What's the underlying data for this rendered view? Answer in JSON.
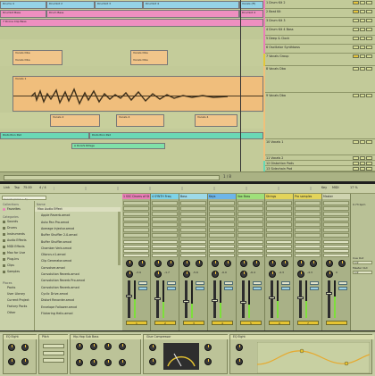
{
  "arrangement": {
    "clips": [
      {
        "label": "Drums 4",
        "lane": 0
      },
      {
        "label": "Drumkit 2",
        "lane": 0
      },
      {
        "label": "Drumkit 3",
        "lane": 0
      },
      {
        "label": "Drumkit 4",
        "lane": 0
      },
      {
        "label": "Vocals (ff)",
        "lane": 0
      },
      {
        "label": "Drumkit Bass",
        "lane": 1
      },
      {
        "label": "Drum Bass",
        "lane": 1
      },
      {
        "label": "Drumkit 4",
        "lane": 1
      },
      {
        "label": "7 Drone Clip Bass",
        "lane": 2
      },
      {
        "label": "Vocals Dba",
        "lane": 4
      },
      {
        "label": "Vocals Dba",
        "lane": 4
      },
      {
        "label": "Vocals Dba",
        "lane": 5
      },
      {
        "label": "Vocals Dba",
        "lane": 5
      },
      {
        "label": "Vocals 1",
        "lane": 6
      },
      {
        "label": "Vocals 2",
        "lane": 7
      },
      {
        "label": "Vocals 4",
        "lane": 7
      },
      {
        "label": "Vocals 4",
        "lane": 7
      },
      {
        "label": "Distortion Pad",
        "lane": 8
      },
      {
        "label": "Distortion Pad",
        "lane": 8
      },
      {
        "label": "A Rorshi Rifage",
        "lane": 9
      }
    ],
    "tracks": [
      {
        "name": "1 Drum Kit 2",
        "color": "#e97fb7",
        "active": true
      },
      {
        "name": "2 Beat Kit",
        "color": "#e97fb7",
        "active": true
      },
      {
        "name": "3 Drum Kit 3",
        "color": "#e97fb7",
        "active": false
      },
      {
        "name": "4 Drum Kit 4 Bass",
        "color": "#e97fb7",
        "active": false
      },
      {
        "name": "5 Deep & Clock",
        "color": "#e97fb7",
        "active": false
      },
      {
        "name": "6 Oscillator Synthbass",
        "color": "#e97fb7",
        "active": false
      },
      {
        "name": "7 Vocals Group",
        "color": "#e3c73a",
        "active": true
      },
      {
        "name": "8 Vocals Dba",
        "color": "#f0c07a",
        "active": false
      },
      {
        "name": "9 Vocals Dba",
        "color": "#f0c07a",
        "active": false
      },
      {
        "name": "10 Vocals 1",
        "color": "#f0c07a",
        "active": false
      },
      {
        "name": "11 Vocals 2",
        "color": "#f0c07a",
        "active": false
      },
      {
        "name": "12 Distortion Pads",
        "color": "#66d8b4",
        "active": false
      },
      {
        "name": "13 Sidechain Pad",
        "color": "#66d8b4",
        "active": false
      },
      {
        "name": "14 Sidechain Pad",
        "color": "#66d8b4",
        "active": false
      },
      {
        "name": "15 Accept Pillows",
        "color": "#66d8b4",
        "active": false
      },
      {
        "name": "16 Vibe House Plucks",
        "color": "#66d8b4",
        "active": false
      },
      {
        "name": "A Reverb | Compressor",
        "color": "#cfd4b0",
        "active": false
      },
      {
        "name": "B Delay",
        "color": "#cfd4b0",
        "active": false
      },
      {
        "name": "Master",
        "color": "#cfd4b0",
        "active": false
      }
    ],
    "footer_position": "1 / 8"
  },
  "toolbar": {
    "items": [
      "Link",
      "Tap",
      "75.00",
      "4 / 4",
      "Key",
      "MIDI",
      "17 %"
    ]
  },
  "browser": {
    "search_placeholder": "Search (Cmd + F)",
    "collections_header": "Collections",
    "collections": [
      "Favorites"
    ],
    "categories_header": "Categories",
    "categories": [
      "Sounds",
      "Drums",
      "Instruments",
      "Audio Effects",
      "MIDI Effects",
      "Max for Live",
      "Plug-Ins",
      "Clips",
      "Samples"
    ],
    "places_header": "Places",
    "places": [
      "Packs",
      "User Library",
      "Current Project",
      "Factory Packs",
      "Other"
    ],
    "name_header": "Name",
    "items": [
      "Max Audio Effect",
      "Apple Reverb.amxd",
      "Auto Pan Pro.amxd",
      "Average Injector.amxd",
      "Buffer Shuffler 2.0.amxd",
      "Buffer Shuffler.amxd",
      "Chamber Verb.amxd",
      "CKoncs.n1.amxd",
      "Clip Generator.amxd",
      "Convolver.amxd",
      "Convolution Reverb.amxd",
      "Convolution Reverb Pro.amxd",
      "Convolution Reverb.amxd",
      "Cyclic Drive.amxd",
      "Distort Recorder.amxd",
      "Envelope Follower.amxd",
      "Flickering Helix.amxd"
    ]
  },
  "mixer": {
    "channels": [
      {
        "name": "1 SSC Drums of St",
        "color": "#e97fb7",
        "volume_db": "-3.9",
        "pan": "C",
        "track_number": "1"
      },
      {
        "name": "4 SYNTH Freq",
        "color": "#7ed3e8",
        "volume_db": "-1.7",
        "pan": "C",
        "track_number": "2"
      },
      {
        "name": "Bass",
        "color": "#9dd9e8",
        "volume_db": "-5.6",
        "pan": "C",
        "track_number": "3"
      },
      {
        "name": "Keys",
        "color": "#6db5e8",
        "volume_db": "-6.0",
        "pan": "C",
        "track_number": "4"
      },
      {
        "name": "Vox Bass",
        "color": "#9fe07a",
        "volume_db": "-6.4",
        "pan": "C",
        "track_number": "5"
      },
      {
        "name": "Strings",
        "color": "#e3d45a",
        "volume_db": "-4.3",
        "pan": "C",
        "track_number": "6"
      },
      {
        "name": "Pro samples",
        "color": "#e3d45a",
        "volume_db": "-4.3",
        "pan": "C",
        "track_number": "7"
      },
      {
        "name": "Master",
        "color": "#cfd4b0",
        "volume_db": "0",
        "pan": "C",
        "track_number": ""
      }
    ],
    "master_side": {
      "cue_label": "Cue Out",
      "cue_value": "1/2",
      "master_label": "Master Out",
      "master_value": "1/2",
      "tempo": "0.73 bpm"
    }
  },
  "devices": [
    {
      "title": "EQ Eight",
      "type": "eq"
    },
    {
      "title": "Pitch",
      "type": "pitch"
    },
    {
      "title": "Hip-Hop Sub Bass",
      "type": "instrument"
    },
    {
      "title": "Glue Compressor",
      "type": "glue"
    },
    {
      "title": "EQ Eight",
      "type": "eq2"
    }
  ],
  "colors": {
    "arrangement_bg": "#bfc896",
    "accent": "#e6c431",
    "pink": "#e97fb7",
    "cyan": "#66d8b4",
    "orange": "#f0c07a"
  }
}
